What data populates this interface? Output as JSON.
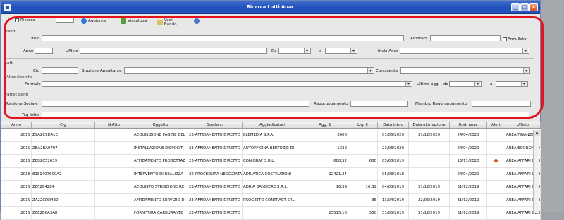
{
  "window": {
    "title": "Ricerca Lotti Anac"
  },
  "toolbar": {
    "modalita_label": "Ricerca",
    "aggiorna_label": "Aggiorna",
    "visualizza_label": "Visualizza",
    "vedi_bando_label": "Vedi Bando"
  },
  "bandi": {
    "section": "Bandi",
    "titolo_label": "Titolo",
    "abstract_label": "Abstract",
    "annullato_label": "Annullato",
    "anno_label": "Anno",
    "ufficio_label": "Ufficio",
    "da_label": "Da",
    "a_label": "a",
    "invio_anac_label": "Invio Anac"
  },
  "lotti": {
    "section": "Lotti",
    "cig_label": "Cig",
    "stazione_label": "Stazione Appaltante",
    "contraente_label": "Contraente"
  },
  "altre": {
    "section": "Altre ricerche",
    "formule_label": "Formule",
    "ultimo_agg_label": "Ultimo agg.",
    "da_label": "da",
    "a_label": "a"
  },
  "partecipanti": {
    "section": "Partecipanti",
    "ragione_label": "Ragione Sociale",
    "raggruppamento_label": "Raggruppamento",
    "membro_label": "Membro Raggruppamento",
    "tag_label": "Tag lotto"
  },
  "table": {
    "columns": [
      "Anno",
      "Cig",
      "N.Atto",
      "Oggetto",
      "Scelta c.",
      "Aggiudicatari",
      "Agg. €",
      "Liq. €",
      "Data inizio",
      "Data ultimazione",
      "Upd. anac",
      "Alert",
      "Ufficio"
    ],
    "rows": [
      [
        "2019",
        "Z9A2C9DA1E",
        "",
        "ACQUISIZIONE PAGINE DEL",
        "23-AFFIDAMENTO DIRETTO",
        "ELEMEDIA S.P.A.",
        "3600",
        "",
        "01/06/2020",
        "31/12/2020",
        "24/04/2020",
        "",
        "AREA FINANZIARIA"
      ],
      [
        "2019",
        "ZBA2BA9797",
        "",
        "INSTALLAZIONE DISPOSITI",
        "23-AFFIDAMENTO DIRETTO",
        "AUTOFFICINA BERTOZZI DI",
        "1332",
        "",
        "23/03/2020",
        "",
        "24/04/2020",
        "",
        "AREA ECONOMATO"
      ],
      [
        "2019",
        "ZEB2C52639",
        "",
        "AFFIDAMENTO PROGETTAZ",
        "23-AFFIDAMENTO DIRETTO",
        "CONIGRAF S.R.L.",
        "688,52",
        "680",
        "05/03/2019",
        "",
        "13/11/2020",
        "dot",
        "AREA AFFARI GEN"
      ],
      [
        "2018",
        "8181407600A2",
        "",
        "INTERVENTO DI REALIZZA",
        "22-PROCEDURA NEGOZIATA",
        "ADRIATICA COSTRUZIONI",
        "92421,34",
        "",
        "05/03/2018",
        "",
        "24/04/2020",
        "",
        "AREA AFFARI GEN"
      ],
      [
        "2019",
        "ZEF2C42E4",
        "",
        "ACQUISTO STRISCIONE RE",
        "23-AFFIDAMENTO DIRETTO",
        "ADRIA BANDIERE S.R.L.",
        "16,39",
        "16,39",
        "04/03/2019",
        "31/12/2019",
        "31/12/2019",
        "",
        "AREA AFFARI GEN"
      ],
      [
        "2019",
        "ZA22CDD430",
        "",
        "AFFIDAMENTO SERVIZIO DI",
        "23-AFFIDAMENTO DIRETTO",
        "PROGETTO CONTRACT SRL",
        "",
        "35",
        "13/04/2019",
        "22/05/2019",
        "31/12/2019",
        "",
        "AREA AFFARI GEN"
      ],
      [
        "2019",
        "Z6E2B6A3A8",
        "",
        "FORNITURA CARBURANTE",
        "23-AFFIDAMENTO DIRETTO",
        "",
        "23515,18",
        "550",
        "31/05/2019",
        "31/12/2019",
        "31/12/2019",
        "",
        "AREA AFFARI GEN"
      ]
    ]
  }
}
